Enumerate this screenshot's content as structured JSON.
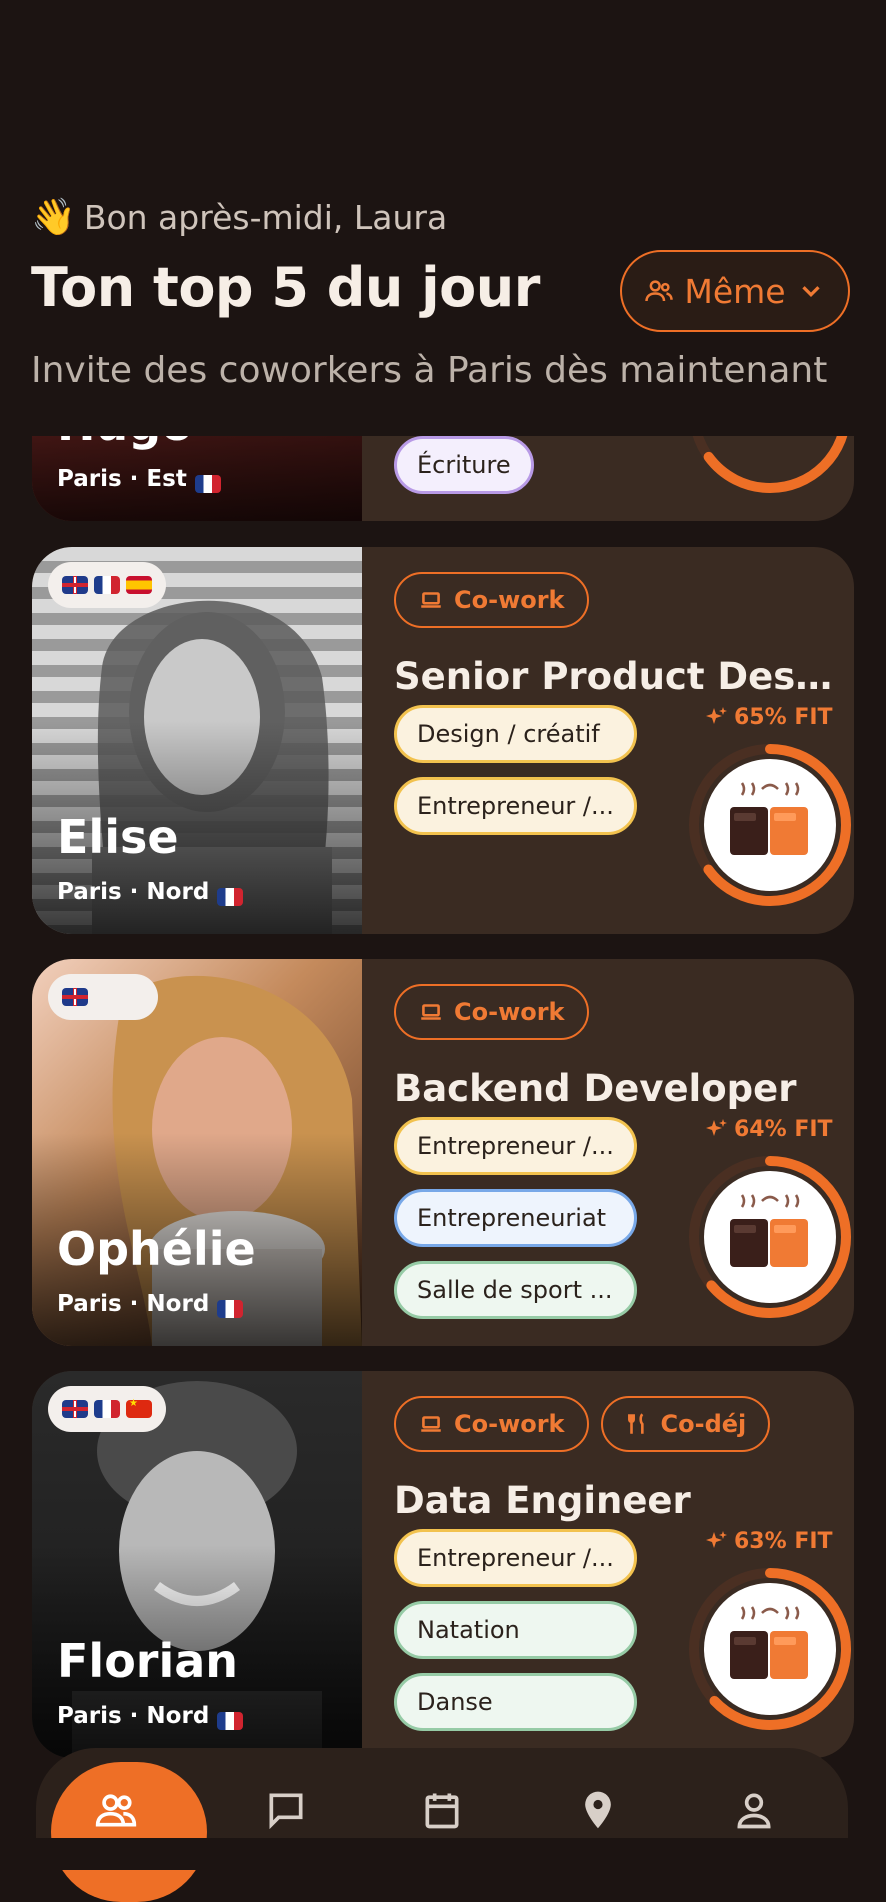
{
  "header": {
    "greeting": "Bon après-midi, Laura",
    "title": "Ton top 5 du jour",
    "subtitle": "Invite des coworkers à Paris dès maintenant",
    "filter_label": "Même"
  },
  "cards": [
    {
      "name": "Hugo",
      "location": "Paris · Est",
      "tags": [
        {
          "label": "Écriture",
          "color": "purple"
        }
      ],
      "fit": ""
    },
    {
      "name": "Elise",
      "location": "Paris · Nord",
      "languages": [
        "gb",
        "fr",
        "es"
      ],
      "activities": [
        "Co-work"
      ],
      "job": "Senior Product Desi...",
      "tags": [
        {
          "label": "Design / créatif",
          "color": "yellow"
        },
        {
          "label": "Entrepreneur /...",
          "color": "yellow"
        }
      ],
      "fit_label": "65% FIT",
      "fit": 0.65
    },
    {
      "name": "Ophélie",
      "location": "Paris · Nord",
      "languages": [
        "gb"
      ],
      "activities": [
        "Co-work"
      ],
      "job": "Backend Developer",
      "tags": [
        {
          "label": "Entrepreneur /...",
          "color": "yellow"
        },
        {
          "label": "Entrepreneuriat",
          "color": "blue"
        },
        {
          "label": "Salle de sport ...",
          "color": "green"
        }
      ],
      "fit_label": "64% FIT",
      "fit": 0.64
    },
    {
      "name": "Florian",
      "location": "Paris · Nord",
      "languages": [
        "gb",
        "fr",
        "cn"
      ],
      "activities": [
        "Co-work",
        "Co-déj"
      ],
      "job": "Data Engineer",
      "tags": [
        {
          "label": "Entrepreneur /...",
          "color": "yellow"
        },
        {
          "label": "Natation",
          "color": "green"
        },
        {
          "label": "Danse",
          "color": "green"
        }
      ],
      "fit_label": "63% FIT",
      "fit": 0.63
    }
  ],
  "tabbar": [
    "people-icon",
    "chat-icon",
    "calendar-icon",
    "location-icon",
    "profile-icon"
  ],
  "colors": {
    "accent": "#ee6f26",
    "card_bg": "#3a2b22",
    "page_bg": "#1c1412"
  }
}
